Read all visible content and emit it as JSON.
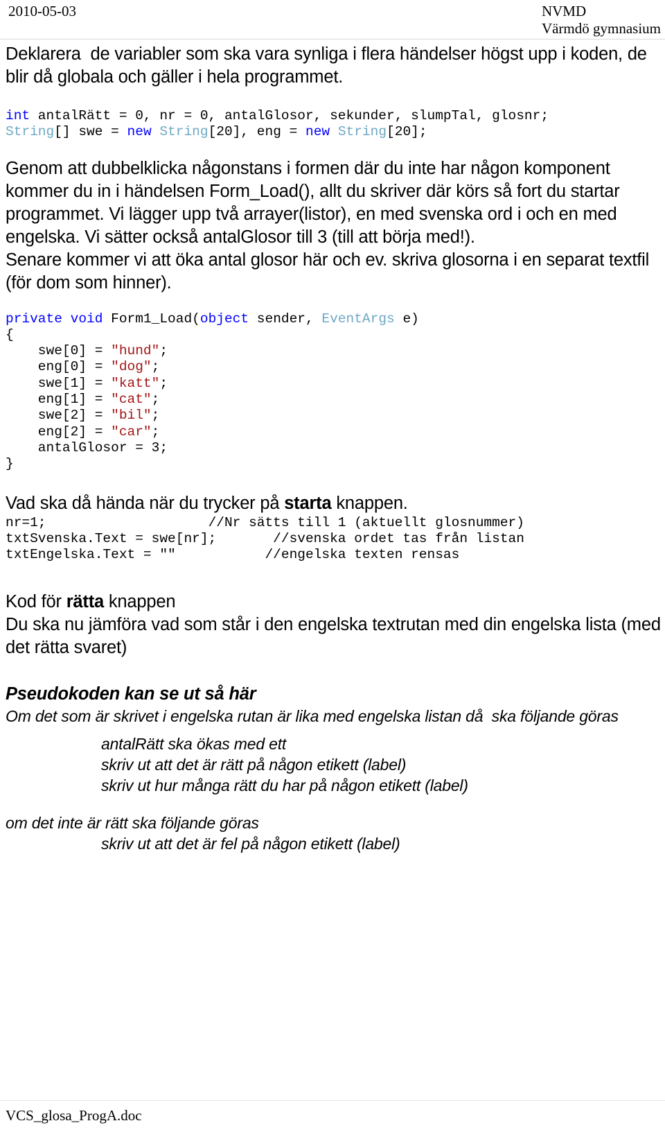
{
  "header": {
    "date": "2010-05-03",
    "org_line1": "NVMD",
    "org_line2": "Värmdö gymnasium"
  },
  "intro": {
    "paragraph": "Deklarera  de variabler som ska vara synliga i flera händelser högst upp i koden, de blir då globala och gäller i hela programmet."
  },
  "code_declarations": {
    "line1_kw": "int",
    "line1_rest": " antalRätt = 0, nr = 0, antalGlosor, sekunder, slumpTal, glosnr;",
    "line2_type1": "String",
    "line2_a": "[] swe = ",
    "line2_kw1": "new",
    "line2_b": " ",
    "line2_type2": "String",
    "line2_c": "[20], eng = ",
    "line2_kw2": "new",
    "line2_d": " ",
    "line2_type3": "String",
    "line2_e": "[20];"
  },
  "explanation": {
    "paragraph": "Genom att dubbelklicka någonstans i formen där du inte har någon komponent kommer du in i händelsen Form_Load(), allt du skriver där körs så fort du startar programmet. Vi lägger upp två arrayer(listor), en med svenska ord i och en med engelska. Vi sätter också antalGlosor till 3 (till att börja med!).",
    "paragraph2": "Senare kommer vi att öka antal glosor här och ev. skriva glosorna i en separat textfil (för dom som hinner)."
  },
  "code_formload": {
    "sig_kw1": "private",
    "sig_sp1": " ",
    "sig_kw2": "void",
    "sig_name": " Form1_Load(",
    "sig_kw3": "object",
    "sig_mid": " sender, ",
    "sig_type": "EventArgs",
    "sig_end": " e)",
    "brace_open": "{",
    "lines": [
      {
        "pre": "    swe[0] = ",
        "str": "\"hund\"",
        "post": ";"
      },
      {
        "pre": "    eng[0] = ",
        "str": "\"dog\"",
        "post": ";"
      },
      {
        "pre": "    swe[1] = ",
        "str": "\"katt\"",
        "post": ";"
      },
      {
        "pre": "    eng[1] = ",
        "str": "\"cat\"",
        "post": ";"
      },
      {
        "pre": "    swe[2] = ",
        "str": "\"bil\"",
        "post": ";"
      },
      {
        "pre": "    eng[2] = ",
        "str": "\"car\"",
        "post": ";"
      },
      {
        "pre": "    antalGlosor = 3;",
        "str": "",
        "post": ""
      }
    ],
    "brace_close": "}"
  },
  "starta_section": {
    "heading_pre": "Vad ska då hända när du trycker på ",
    "heading_bold": "starta",
    "heading_post": " knappen.",
    "code_rows": [
      {
        "code": "nr=1;",
        "comment": "//Nr sätts till 1 (aktuellt glosnummer)"
      },
      {
        "code": "txtSvenska.Text = swe[nr];",
        "comment": "//svenska ordet tas från listan"
      },
      {
        "code": "txtEngelska.Text = \"\"",
        "comment": "//engelska texten rensas"
      }
    ]
  },
  "ratta_section": {
    "heading_pre": "Kod för ",
    "heading_bold": "rätta",
    "heading_post": " knappen",
    "paragraph": "Du ska nu jämföra vad som står i den engelska textrutan med din engelska lista (med det rätta svaret)"
  },
  "pseudocode": {
    "title": "Pseudokoden kan se ut så här",
    "condition_true": "Om det som är skrivet i engelska rutan är lika med engelska listan då  ska följande göras",
    "true_steps": [
      "antalRätt ska ökas med ett",
      "skriv ut att det är rätt på någon etikett (label)",
      "skriv ut hur många rätt du har på någon etikett (label)"
    ],
    "condition_false": "om det inte är rätt ska följande göras",
    "false_steps": [
      "skriv ut att det är fel på någon etikett (label)"
    ]
  },
  "footer": {
    "filename": "VCS_glosa_ProgA.doc"
  },
  "colors": {
    "keyword": "#0000ff",
    "type": "#6fa8c4",
    "string": "#a31515",
    "text": "#000000"
  }
}
